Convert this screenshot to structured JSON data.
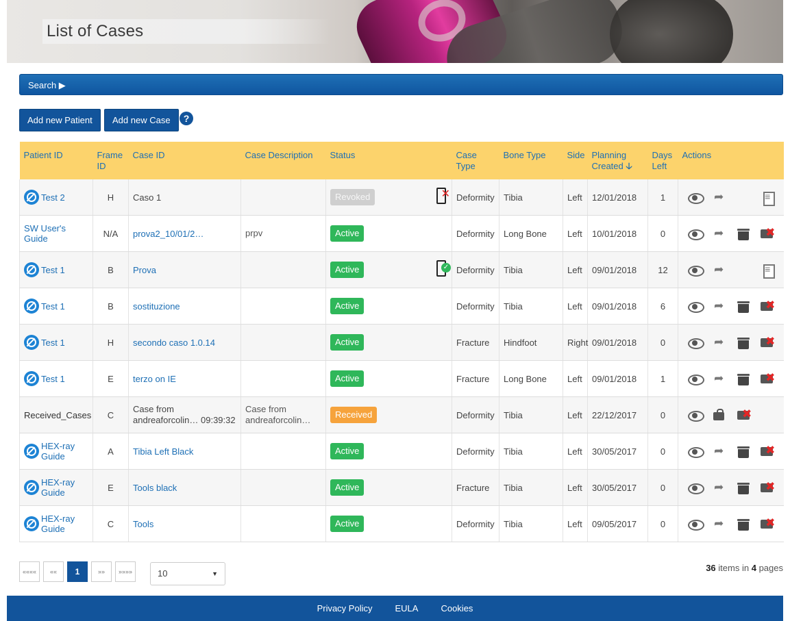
{
  "header": {
    "title": "List of Cases"
  },
  "search": {
    "label": "Search ▶"
  },
  "toolbar": {
    "add_patient": "Add new Patient",
    "add_case": "Add new Case",
    "help": "?"
  },
  "table": {
    "columns": [
      "Patient ID",
      "Frame ID",
      "Case ID",
      "Case Description",
      "Status",
      "Case Type",
      "Bone Type",
      "Side",
      "Planning Created",
      "Days Left",
      "Actions"
    ],
    "rows": [
      {
        "patient": "Test 2",
        "frame": "H",
        "case_id": "Caso 1",
        "desc": "",
        "status": "Revoked",
        "case_type": "Deformity",
        "bone": "Tibia",
        "side": "Left",
        "planning": "12/01/2018",
        "days": "1"
      },
      {
        "patient": "SW User's Guide",
        "frame": "N/A",
        "case_id": "prova2_10/01/2…",
        "desc": "prpv",
        "status": "Active",
        "case_type": "Deformity",
        "bone": "Long Bone",
        "side": "Left",
        "planning": "10/01/2018",
        "days": "0"
      },
      {
        "patient": "Test 1",
        "frame": "B",
        "case_id": "Prova",
        "desc": "",
        "status": "Active",
        "case_type": "Deformity",
        "bone": "Tibia",
        "side": "Left",
        "planning": "09/01/2018",
        "days": "12"
      },
      {
        "patient": "Test 1",
        "frame": "B",
        "case_id": "sostituzione",
        "desc": "",
        "status": "Active",
        "case_type": "Deformity",
        "bone": "Tibia",
        "side": "Left",
        "planning": "09/01/2018",
        "days": "6"
      },
      {
        "patient": "Test 1",
        "frame": "H",
        "case_id": "secondo caso 1.0.14",
        "desc": "",
        "status": "Active",
        "case_type": "Fracture",
        "bone": "Hindfoot",
        "side": "Right",
        "planning": "09/01/2018",
        "days": "0"
      },
      {
        "patient": "Test 1",
        "frame": "E",
        "case_id": "terzo on IE",
        "desc": "",
        "status": "Active",
        "case_type": "Fracture",
        "bone": "Long Bone",
        "side": "Left",
        "planning": "09/01/2018",
        "days": "1"
      },
      {
        "patient": "Received_Cases",
        "frame": "C",
        "case_id_l1": "Case from",
        "case_id_l2": "andreaforcolin… 09:39:32",
        "desc_l1": "Case from",
        "desc_l2": "andreaforcolin…",
        "status": "Received",
        "case_type": "Deformity",
        "bone": "Tibia",
        "side": "Left",
        "planning": "22/12/2017",
        "days": "0"
      },
      {
        "patient": "HEX-ray Guide",
        "frame": "A",
        "case_id": "Tibia Left Black",
        "desc": "",
        "status": "Active",
        "case_type": "Deformity",
        "bone": "Tibia",
        "side": "Left",
        "planning": "30/05/2017",
        "days": "0"
      },
      {
        "patient": "HEX-ray Guide",
        "frame": "E",
        "case_id": "Tools black",
        "desc": "",
        "status": "Active",
        "case_type": "Fracture",
        "bone": "Tibia",
        "side": "Left",
        "planning": "30/05/2017",
        "days": "0"
      },
      {
        "patient": "HEX-ray Guide",
        "frame": "C",
        "case_id": "Tools",
        "desc": "",
        "status": "Active",
        "case_type": "Deformity",
        "bone": "Tibia",
        "side": "Left",
        "planning": "09/05/2017",
        "days": "0"
      }
    ]
  },
  "pagination": {
    "first": "««««",
    "prev": "««",
    "current": "1",
    "next": "»»",
    "last": "»»»»",
    "page_size": "10",
    "caret": "▼",
    "total_items": "36",
    "items_in": "items in",
    "pages": "4",
    "pages_label": "pages"
  },
  "footer": {
    "privacy": "Privacy Policy",
    "eula": "EULA",
    "cookies": "Cookies"
  }
}
